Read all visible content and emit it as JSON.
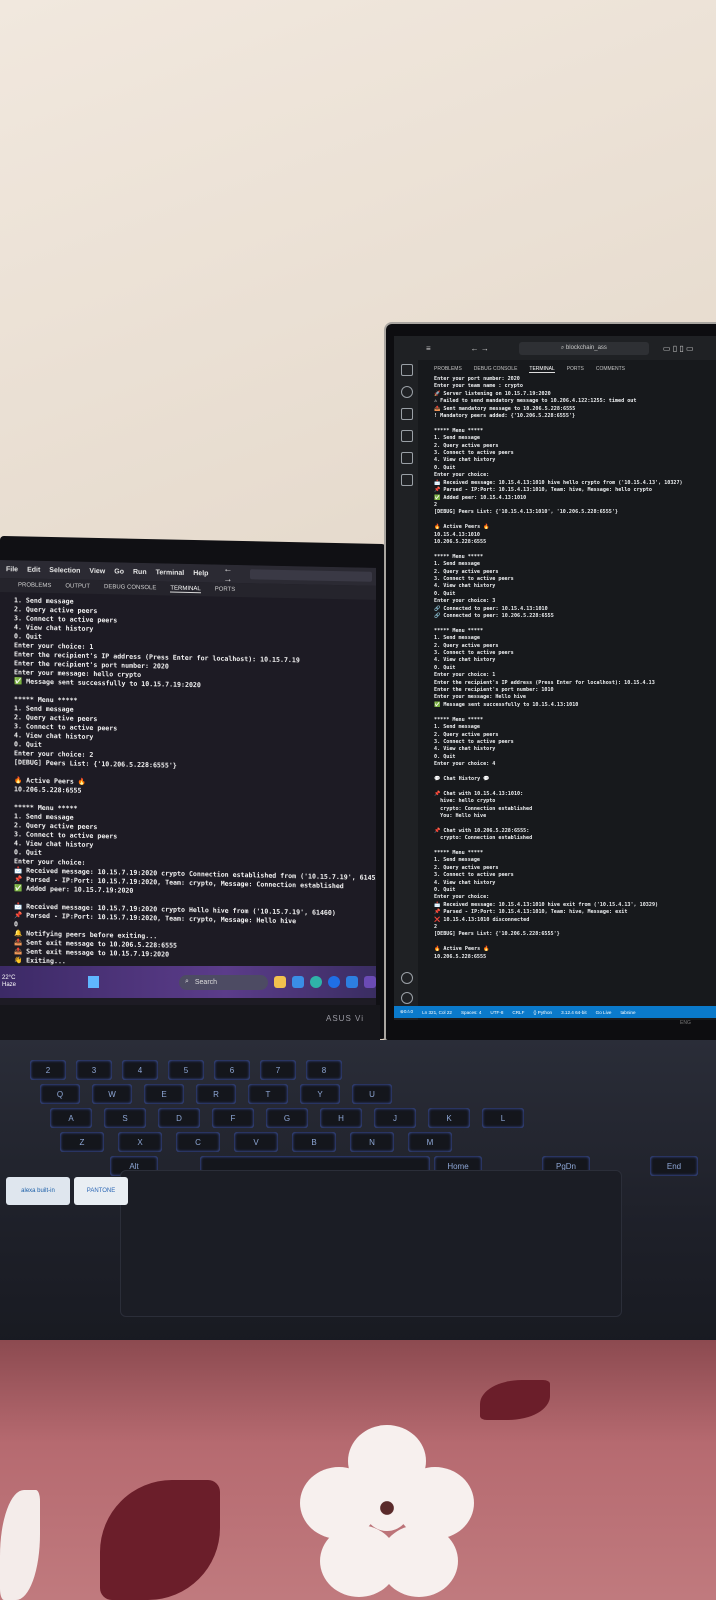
{
  "left_laptop": {
    "menu": [
      "File",
      "Edit",
      "Selection",
      "View",
      "Go",
      "Run",
      "Terminal",
      "Help"
    ],
    "nav_glyph": "← →",
    "panel_tabs": [
      "PROBLEMS",
      "OUTPUT",
      "DEBUG CONSOLE",
      "TERMINAL",
      "PORTS"
    ],
    "active_tab": "TERMINAL",
    "terminal_lines": [
      "1. Send message",
      "2. Query active peers",
      "3. Connect to active peers",
      "4. View chat history",
      "0. Quit",
      "Enter your choice: 1",
      "Enter the recipient's IP address (Press Enter for localhost): 10.15.7.19",
      "Enter the recipient's port number: 2020",
      "Enter your message: hello crypto",
      "✅ Message sent successfully to 10.15.7.19:2020",
      "",
      "***** Menu *****",
      "1. Send message",
      "2. Query active peers",
      "3. Connect to active peers",
      "4. View chat history",
      "0. Quit",
      "Enter your choice: 2",
      "[DEBUG] Peers List: {'10.206.5.228:6555'}",
      "",
      "🔥 Active Peers 🔥",
      "10.206.5.228:6555",
      "",
      "***** Menu *****",
      "1. Send message",
      "2. Query active peers",
      "3. Connect to active peers",
      "4. View chat history",
      "0. Quit",
      "Enter your choice:",
      "📩 Received message: 10.15.7.19:2020 crypto Connection established from ('10.15.7.19', 61453)",
      "📌 Parsed - IP:Port: 10.15.7.19:2020, Team: crypto, Message: Connection established",
      "✅ Added peer: 10.15.7.19:2020",
      "",
      "📩 Received message: 10.15.7.19:2020 crypto Hello hive from ('10.15.7.19', 61460)",
      "📌 Parsed - IP:Port: 10.15.7.19:2020, Team: crypto, Message: Hello hive",
      "0",
      "🔔 Notifying peers before exiting...",
      "📤 Sent exit message to 10.206.5.228:6555",
      "📤 Sent exit message to 10.15.7.19:2020",
      "👋 Exiting..."
    ],
    "status_glyph": "⊗0⚠0",
    "taskbar": {
      "temp": "22°C",
      "weather": "Haze",
      "search": "Search"
    },
    "brand": "ASUS Vi"
  },
  "right_monitor": {
    "search_box": "blockchain_ass",
    "panel_tabs": [
      "PROBLEMS",
      "DEBUG CONSOLE",
      "TERMINAL",
      "PORTS",
      "COMMENTS"
    ],
    "active_tab": "TERMINAL",
    "terminal_lines": [
      "Enter your port number: 2020",
      "Enter your team name : crypto",
      "🚀 Server listening on 10.15.7.19:2020",
      "⚠ Failed to send mandatory message to 10.206.4.122:1255: timed out",
      "📤 Sent mandatory message to 10.206.5.228:6555",
      "! Mandatory peers added: {'10.206.5.228:6555'}",
      "",
      "***** Menu *****",
      "1. Send message",
      "2. Query active peers",
      "3. Connect to active peers",
      "4. View chat history",
      "0. Quit",
      "Enter your choice:",
      "📩 Received message: 10.15.4.13:1010 hive hello crypto from ('10.15.4.13', 10327)",
      "📌 Parsed - IP:Port: 10.15.4.13:1010, Team: hive, Message: hello crypto",
      "✅ Added peer: 10.15.4.13:1010",
      "2",
      "[DEBUG] Peers List: {'10.15.4.13:1010', '10.206.5.228:6555'}",
      "",
      "🔥 Active Peers 🔥",
      "10.15.4.13:1010",
      "10.206.5.228:6555",
      "",
      "***** Menu *****",
      "1. Send message",
      "2. Query active peers",
      "3. Connect to active peers",
      "4. View chat history",
      "0. Quit",
      "Enter your choice: 3",
      "🔗 Connected to peer: 10.15.4.13:1010",
      "🔗 Connected to peer: 10.206.5.228:6555",
      "",
      "***** Menu *****",
      "1. Send message",
      "2. Query active peers",
      "3. Connect to active peers",
      "4. View chat history",
      "0. Quit",
      "Enter your choice: 1",
      "Enter the recipient's IP address (Press Enter for localhost): 10.15.4.13",
      "Enter the recipient's port number: 1010",
      "Enter your message: Hello hive",
      "✅ Message sent successfully to 10.15.4.13:1010",
      "",
      "***** Menu *****",
      "1. Send message",
      "2. Query active peers",
      "3. Connect to active peers",
      "4. View chat history",
      "0. Quit",
      "Enter your choice: 4",
      "",
      "💬 Chat History 💬",
      "",
      "📌 Chat with 10.15.4.13:1010:",
      "  hive: hello crypto",
      "  crypto: Connection established",
      "  You: Hello hive",
      "",
      "📌 Chat with 10.206.5.228:6555:",
      "  crypto: Connection established",
      "",
      "***** Menu *****",
      "1. Send message",
      "2. Query active peers",
      "3. Connect to active peers",
      "4. View chat history",
      "0. Quit",
      "Enter your choice:",
      "📩 Received message: 10.15.4.13:1010 hive exit from ('10.15.4.13', 10329)",
      "📌 Parsed - IP:Port: 10.15.4.13:1010, Team: hive, Message: exit",
      "❌ 10.15.4.13:1010 disconnected",
      "2",
      "[DEBUG] Peers List: {'10.206.5.228:6555'}",
      "",
      "🔥 Active Peers 🔥",
      "10.206.5.228:6555"
    ],
    "status_bar": [
      "⊗0⚠0",
      "Ln 321, Col 22",
      "Spaces: 4",
      "UTF-8",
      "CRLF",
      "{} Python",
      "3.12.4 64-bit",
      "Go Live",
      "tabnine"
    ],
    "lang": "ENG"
  },
  "keyboard": {
    "row1": [
      "2",
      "3",
      "4",
      "5",
      "6",
      "7",
      "8"
    ],
    "row2": [
      "Q",
      "W",
      "E",
      "R",
      "T",
      "Y",
      "U"
    ],
    "row3": [
      "A",
      "S",
      "D",
      "F",
      "G",
      "H",
      "J",
      "K",
      "L"
    ],
    "row4": [
      "Z",
      "X",
      "C",
      "V",
      "B",
      "N",
      "M"
    ],
    "row5": [
      "Alt",
      "Alt",
      "Ctrl",
      "Home",
      "PgDn",
      "End"
    ],
    "sticker_alexa": "alexa built-in",
    "sticker_pantone": "PANTONE"
  }
}
